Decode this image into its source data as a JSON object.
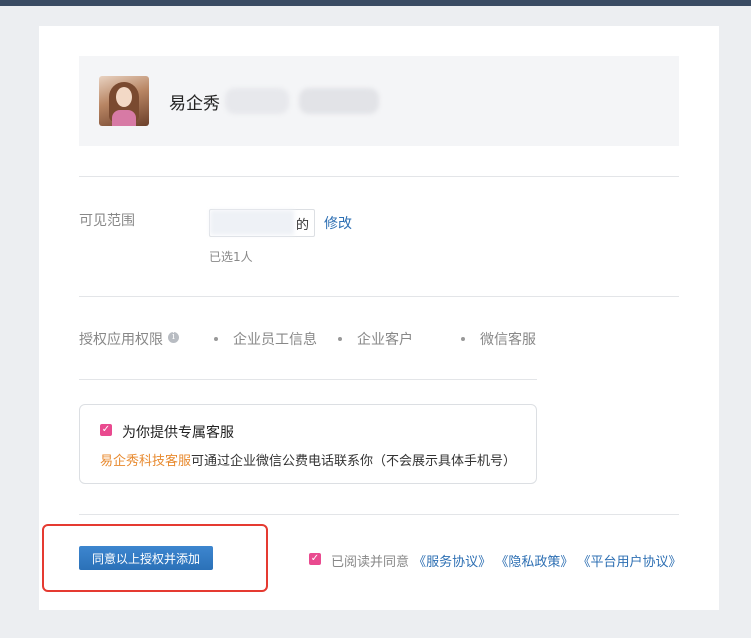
{
  "app": {
    "name": "易企秀"
  },
  "scope": {
    "label": "可见范围",
    "value_suffix": "的",
    "edit_label": "修改",
    "selected_count": "已选1人"
  },
  "permissions": {
    "label": "授权应用权限",
    "info_icon": "info-icon",
    "items": [
      "企业员工信息",
      "企业客户",
      "微信客服"
    ]
  },
  "service": {
    "checked": true,
    "title": "为你提供专属客服",
    "brand": "易企秀科技客服",
    "desc": "可通过企业微信公费电话联系你（不会展示具体手机号）"
  },
  "footer": {
    "agree_button": "同意以上授权并添加",
    "read_checked": true,
    "read_prefix": "已阅读并同意",
    "links": [
      "《服务协议》",
      "《隐私政策》",
      "《平台用户协议》"
    ]
  },
  "colors": {
    "accent": "#2d6fb3",
    "checkbox": "#e94a8f",
    "brand_orange": "#e88a2f",
    "highlight_red": "#e53a31",
    "topbar": "#3a4b63"
  }
}
